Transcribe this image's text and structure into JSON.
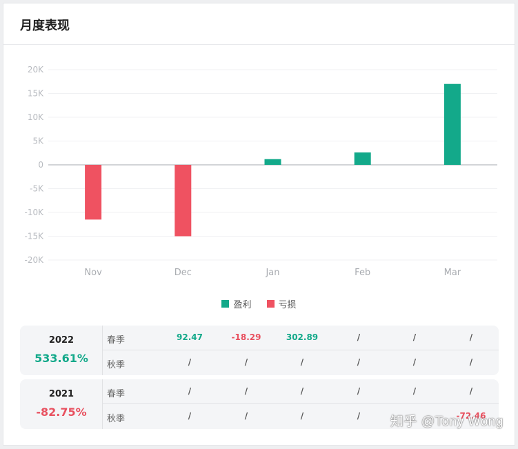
{
  "header": {
    "title": "月度表现"
  },
  "chart_data": {
    "type": "bar",
    "categories": [
      "Nov",
      "Dec",
      "Jan",
      "Feb",
      "Mar"
    ],
    "values": [
      -11500,
      -15000,
      1200,
      2600,
      17000
    ],
    "ylim": [
      -20000,
      20000
    ],
    "yticks": [
      20000,
      15000,
      10000,
      5000,
      0,
      -5000,
      -10000,
      -15000,
      -20000
    ],
    "ytick_labels": [
      "20K",
      "15K",
      "10K",
      "5K",
      "0",
      "-5K",
      "-10K",
      "-15K",
      "-20K"
    ],
    "grid": true,
    "legend": {
      "position": "bottom",
      "entries": [
        {
          "label": "盈利",
          "color": "#13a98a"
        },
        {
          "label": "亏损",
          "color": "#ef5261"
        }
      ]
    },
    "colors": {
      "positive": "#13a98a",
      "negative": "#ef5261"
    }
  },
  "years": [
    {
      "year": "2022",
      "total": "533.61%",
      "total_sign": "pos",
      "rows": [
        {
          "season": "春季",
          "cells": [
            {
              "v": "92.47",
              "c": "pos"
            },
            {
              "v": "-18.29",
              "c": "neg"
            },
            {
              "v": "302.89",
              "c": "pos"
            },
            {
              "v": "/",
              "c": ""
            },
            {
              "v": "/",
              "c": ""
            },
            {
              "v": "/",
              "c": ""
            }
          ]
        },
        {
          "season": "秋季",
          "cells": [
            {
              "v": "/",
              "c": ""
            },
            {
              "v": "/",
              "c": ""
            },
            {
              "v": "/",
              "c": ""
            },
            {
              "v": "/",
              "c": ""
            },
            {
              "v": "/",
              "c": ""
            },
            {
              "v": "/",
              "c": ""
            }
          ]
        }
      ]
    },
    {
      "year": "2021",
      "total": "-82.75%",
      "total_sign": "neg",
      "rows": [
        {
          "season": "春季",
          "cells": [
            {
              "v": "/",
              "c": ""
            },
            {
              "v": "/",
              "c": ""
            },
            {
              "v": "/",
              "c": ""
            },
            {
              "v": "/",
              "c": ""
            },
            {
              "v": "/",
              "c": ""
            },
            {
              "v": "/",
              "c": ""
            }
          ]
        },
        {
          "season": "秋季",
          "cells": [
            {
              "v": "/",
              "c": ""
            },
            {
              "v": "/",
              "c": ""
            },
            {
              "v": "/",
              "c": ""
            },
            {
              "v": "/",
              "c": ""
            },
            {
              "v": "",
              "c": ""
            },
            {
              "v": "-72.46",
              "c": "neg"
            }
          ]
        }
      ]
    }
  ],
  "watermark": "知乎 @Tony Wong"
}
